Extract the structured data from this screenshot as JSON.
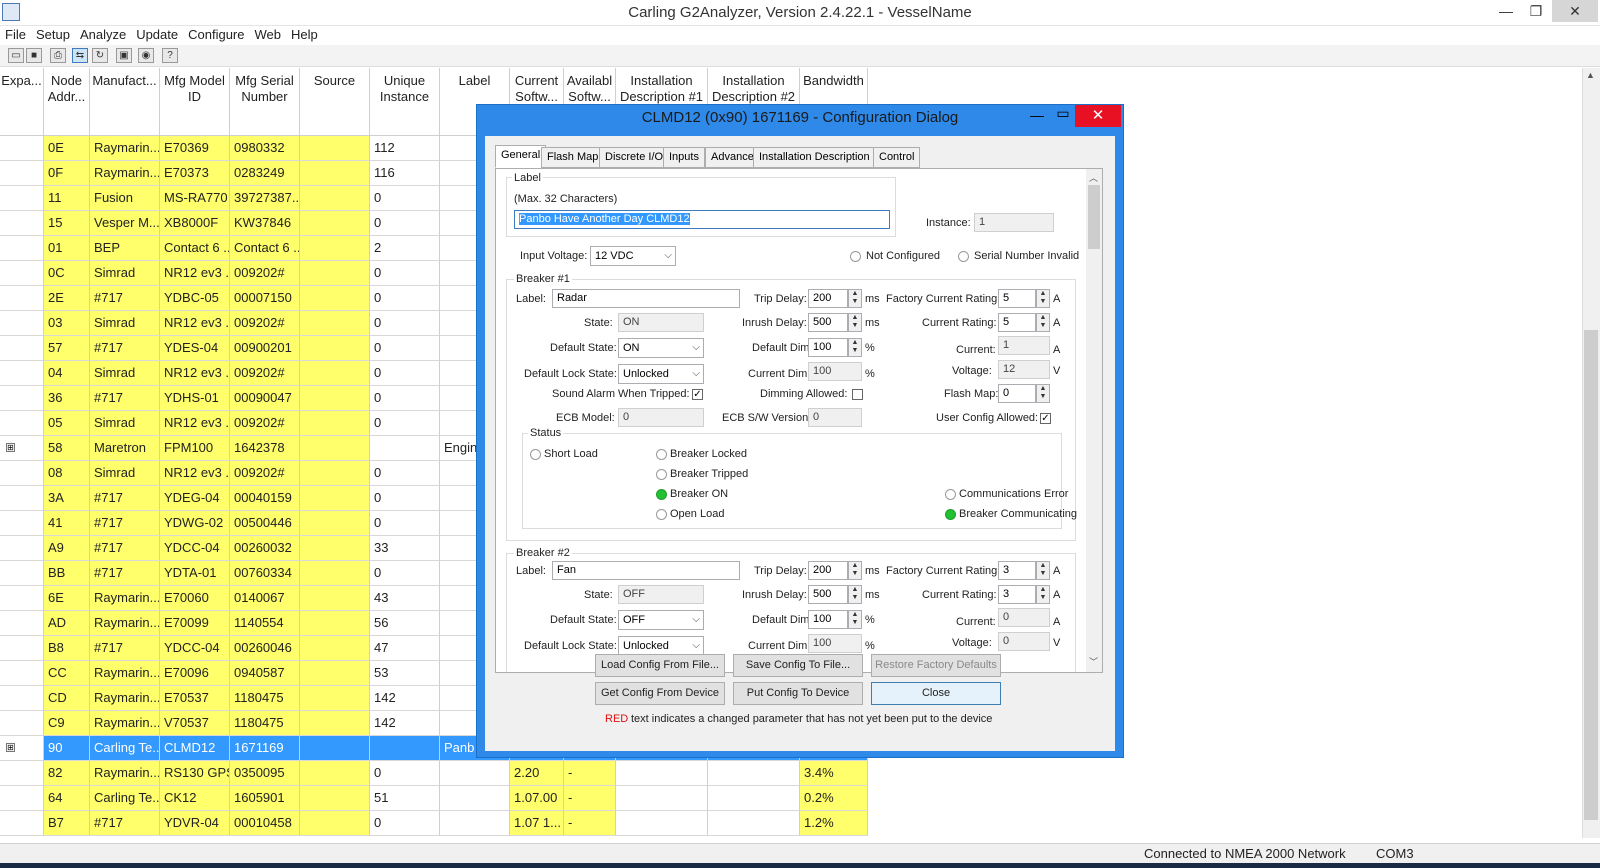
{
  "app": {
    "title": "Carling G2Analyzer, Version 2.4.22.1 - VesselName",
    "minimize": "—",
    "maximize": "❐",
    "close": "✕"
  },
  "menu": [
    "File",
    "Setup",
    "Analyze",
    "Update",
    "Configure",
    "Web",
    "Help"
  ],
  "toolbar_icons": [
    "open-icon",
    "save-icon",
    "print-icon",
    "network-icon",
    "refresh-icon",
    "device-icon",
    "globe-icon",
    "help-icon"
  ],
  "grid": {
    "headers": [
      "Expa...",
      "Node Addr...",
      "Manufact...",
      "Mfg Model ID",
      "Mfg Serial Number",
      "Source",
      "Unique Instance",
      "Label",
      "Current Softw...",
      "Availabl Softw...",
      "Installation Description #1",
      "Installation Description #2",
      "Bandwidth"
    ],
    "rows": [
      {
        "addr": "0E",
        "mfr": "Raymarin...",
        "model": "E70369",
        "serial": "0980332",
        "inst": "112"
      },
      {
        "addr": "0F",
        "mfr": "Raymarin...",
        "model": "E70373",
        "serial": "0283249",
        "inst": "116"
      },
      {
        "addr": "11",
        "mfr": "Fusion",
        "model": "MS-RA770",
        "serial": "39727387...",
        "inst": "0"
      },
      {
        "addr": "15",
        "mfr": "Vesper M...",
        "model": "XB8000F",
        "serial": "KW37846",
        "inst": "0"
      },
      {
        "addr": "01",
        "mfr": "BEP",
        "model": "Contact 6 ...",
        "serial": "Contact 6 ...",
        "inst": "2"
      },
      {
        "addr": "0C",
        "mfr": "Simrad",
        "model": "NR12 ev3 ...",
        "serial": "009202#",
        "inst": "0"
      },
      {
        "addr": "2E",
        "mfr": "#717",
        "model": "YDBC-05",
        "serial": "00007150",
        "inst": "0"
      },
      {
        "addr": "03",
        "mfr": "Simrad",
        "model": "NR12 ev3 ...",
        "serial": "009202#",
        "inst": "0"
      },
      {
        "addr": "57",
        "mfr": "#717",
        "model": "YDES-04",
        "serial": "00900201",
        "inst": "0"
      },
      {
        "addr": "04",
        "mfr": "Simrad",
        "model": "NR12 ev3 ...",
        "serial": "009202#",
        "inst": "0"
      },
      {
        "addr": "36",
        "mfr": "#717",
        "model": "YDHS-01",
        "serial": "00090047",
        "inst": "0"
      },
      {
        "addr": "05",
        "mfr": "Simrad",
        "model": "NR12 ev3 ...",
        "serial": "009202#",
        "inst": "0"
      },
      {
        "addr": "58",
        "mfr": "Maretron",
        "model": "FPM100",
        "serial": "1642378",
        "inst": "",
        "label": "Engin",
        "expand": "⊞"
      },
      {
        "addr": "08",
        "mfr": "Simrad",
        "model": "NR12 ev3 ...",
        "serial": "009202#",
        "inst": "0"
      },
      {
        "addr": "3A",
        "mfr": "#717",
        "model": "YDEG-04",
        "serial": "00040159",
        "inst": "0"
      },
      {
        "addr": "41",
        "mfr": "#717",
        "model": "YDWG-02",
        "serial": "00500446",
        "inst": "0"
      },
      {
        "addr": "A9",
        "mfr": "#717",
        "model": "YDCC-04",
        "serial": "00260032",
        "inst": "33"
      },
      {
        "addr": "BB",
        "mfr": "#717",
        "model": "YDTA-01",
        "serial": "00760334",
        "inst": "0"
      },
      {
        "addr": "6E",
        "mfr": "Raymarin...",
        "model": "E70060",
        "serial": "0140067",
        "inst": "43"
      },
      {
        "addr": "AD",
        "mfr": "Raymarin...",
        "model": "E70099",
        "serial": "1140554",
        "inst": "56"
      },
      {
        "addr": "B8",
        "mfr": "#717",
        "model": "YDCC-04",
        "serial": "00260046",
        "inst": "47"
      },
      {
        "addr": "CC",
        "mfr": "Raymarin...",
        "model": "E70096",
        "serial": "0940587",
        "inst": "53"
      },
      {
        "addr": "CD",
        "mfr": "Raymarin...",
        "model": "E70537",
        "serial": "1180475",
        "inst": "142"
      },
      {
        "addr": "C9",
        "mfr": "Raymarin...",
        "model": "V70537",
        "serial": "1180475",
        "inst": "142"
      },
      {
        "addr": "90",
        "mfr": "Carling Te...",
        "model": "CLMD12",
        "serial": "1671169",
        "inst": "",
        "label": "Panb",
        "expand": "⊞",
        "selected": true
      },
      {
        "addr": "82",
        "mfr": "Raymarin...",
        "model": "RS130 GPS",
        "serial": "0350095",
        "inst": "0",
        "cur": "2.20",
        "avail": "-",
        "bw": "3.4%"
      },
      {
        "addr": "64",
        "mfr": "Carling Te...",
        "model": "CK12",
        "serial": "1605901",
        "inst": "51",
        "cur": "1.07.00",
        "avail": "-",
        "bw": "0.2%"
      },
      {
        "addr": "B7",
        "mfr": "#717",
        "model": "YDVR-04",
        "serial": "00010458",
        "inst": "0",
        "cur": "1.07 1...",
        "avail": "-",
        "bw": "1.2%"
      }
    ]
  },
  "status": {
    "connection": "Connected to NMEA 2000 Network",
    "port": "COM3"
  },
  "dialog": {
    "title": "CLMD12 (0x90) 1671169 - Configuration Dialog",
    "tabs": [
      "General",
      "Flash Map",
      "Discrete I/O",
      "Inputs",
      "Advanced",
      "Installation Description",
      "Control"
    ],
    "label_group": "Label",
    "label_hint": "(Max. 32 Characters)",
    "label_value": "Panbo Have Another Day CLMD12",
    "instance_label": "Instance:",
    "instance_value": "1",
    "input_voltage_label": "Input Voltage:",
    "input_voltage_value": "12 VDC",
    "not_configured": "Not Configured",
    "serial_invalid": "Serial Number Invalid",
    "b1": {
      "title": "Breaker #1",
      "label_l": "Label:",
      "label_v": "Radar",
      "trip_l": "Trip Delay:",
      "trip_v": "200",
      "ms": "ms",
      "fcr_l": "Factory Current Rating:",
      "fcr_v": "5",
      "a": "A",
      "state_l": "State:",
      "state_v": "ON",
      "inrush_l": "Inrush Delay:",
      "inrush_v": "500",
      "cr_l": "Current Rating:",
      "cr_v": "5",
      "ds_l": "Default State:",
      "ds_v": "ON",
      "dd_l": "Default Dim",
      "dd_v": "100",
      "pct": "%",
      "cur_l": "Current:",
      "cur_v": "1",
      "dls_l": "Default Lock State:",
      "dls_v": "Unlocked",
      "cd_l": "Current Dim",
      "cd_v": "100",
      "volt_l": "Voltage:",
      "volt_v": "12",
      "v": "V",
      "alarm_l": "Sound Alarm When Tripped:",
      "dim_l": "Dimming Allowed:",
      "fm_l": "Flash Map:",
      "fm_v": "0",
      "ecb_l": "ECB Model:",
      "ecb_v": "0",
      "sw_l": "ECB S/W Version:",
      "sw_v": "0",
      "uca_l": "User Config Allowed:",
      "status": "Status",
      "short": "Short Load",
      "locked": "Breaker Locked",
      "tripped": "Breaker Tripped",
      "bon": "Breaker ON",
      "open": "Open Load",
      "comerr": "Communications Error",
      "comm": "Breaker Communicating"
    },
    "b2": {
      "title": "Breaker #2",
      "label_l": "Label:",
      "label_v": "Fan",
      "trip_l": "Trip Delay:",
      "trip_v": "200",
      "ms": "ms",
      "fcr_l": "Factory Current Rating:",
      "fcr_v": "3",
      "a": "A",
      "state_l": "State:",
      "state_v": "OFF",
      "inrush_l": "Inrush Delay:",
      "inrush_v": "500",
      "cr_l": "Current Rating:",
      "cr_v": "3",
      "ds_l": "Default State:",
      "ds_v": "OFF",
      "dd_l": "Default Dim",
      "dd_v": "100",
      "pct": "%",
      "cur_l": "Current:",
      "cur_v": "0",
      "dls_l": "Default Lock State:",
      "dls_v": "Unlocked",
      "cd_l": "Current Dim",
      "cd_v": "100",
      "volt_l": "Voltage:",
      "volt_v": "0",
      "v": "V"
    },
    "buttons": {
      "load": "Load Config From File...",
      "save": "Save Config To File...",
      "restore": "Restore Factory Defaults",
      "get": "Get Config From Device",
      "put": "Put Config To Device",
      "close": "Close"
    },
    "note_red": "RED",
    "note": "text indicates a changed parameter that has not yet been put to the device"
  }
}
